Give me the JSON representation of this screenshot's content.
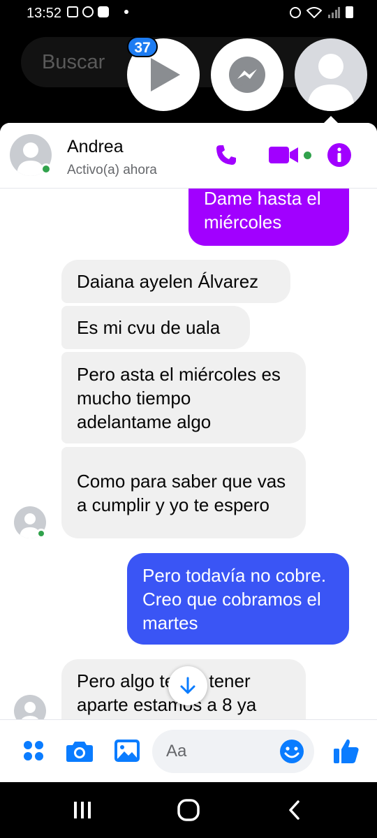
{
  "status_bar": {
    "time": "13:52"
  },
  "search": {
    "placeholder": "Buscar"
  },
  "chat_heads": {
    "badge_count": "37"
  },
  "chat": {
    "contact_name": "Andrea",
    "contact_status": "Activo(a) ahora"
  },
  "messages": [
    {
      "from": "me",
      "text": "Dame hasta el miércoles"
    },
    {
      "from": "them",
      "text": "Daiana ayelen Álvarez"
    },
    {
      "from": "them",
      "text": "Es mi cvu de uala"
    },
    {
      "from": "them",
      "text": "Pero asta el miércoles es mucho tiempo adelantame algo"
    },
    {
      "from": "them",
      "text": "Como para saber que vas a cumplir y yo te espero"
    },
    {
      "from": "me",
      "text": "Pero todavía no cobre. Creo que cobramos el martes"
    },
    {
      "from": "them",
      "text": "Pero algo tenes tener aparte estamos a 8 ya"
    }
  ],
  "composer": {
    "placeholder": "Aa"
  },
  "icons": {
    "header": [
      "phone-icon",
      "video-camera-icon",
      "info-icon"
    ],
    "composer": [
      "apps-icon",
      "camera-icon",
      "gallery-icon",
      "emoji-icon",
      "like-icon"
    ],
    "nav": [
      "recent-apps-icon",
      "home-icon",
      "back-icon"
    ]
  },
  "colors": {
    "accent": "#a100ff",
    "outgoing_purple": "#a100ff",
    "outgoing_blue": "#3a55f5",
    "incoming": "#f0f0f0",
    "online": "#31a24c",
    "composer_icons": "#0a7cff",
    "badge": "#1d7cf2"
  }
}
